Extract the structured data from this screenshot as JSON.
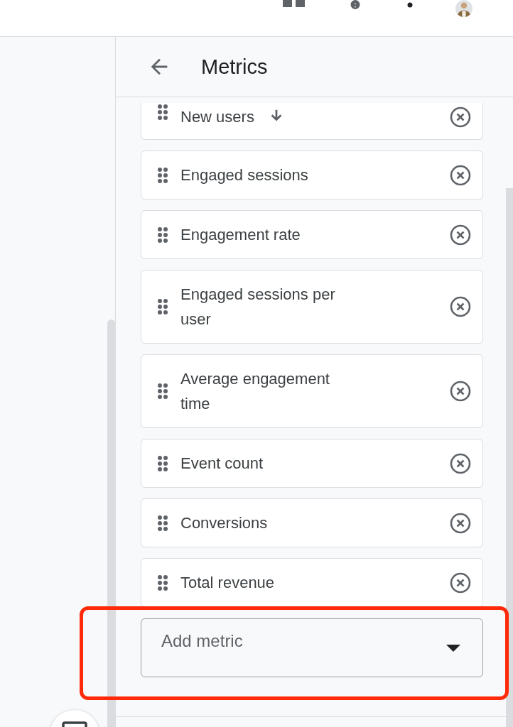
{
  "header": {
    "title": "Metrics"
  },
  "metrics": [
    {
      "name": "New users",
      "sorted": true
    },
    {
      "name": "Engaged sessions",
      "sorted": false
    },
    {
      "name": "Engagement rate",
      "sorted": false
    },
    {
      "name": "Engaged sessions per user",
      "sorted": false
    },
    {
      "name": "Average engagement time",
      "sorted": false
    },
    {
      "name": "Event count",
      "sorted": false
    },
    {
      "name": "Conversions",
      "sorted": false
    },
    {
      "name": "Total revenue",
      "sorted": false
    }
  ],
  "add_metric": {
    "placeholder": "Add metric",
    "highlighted": true
  }
}
